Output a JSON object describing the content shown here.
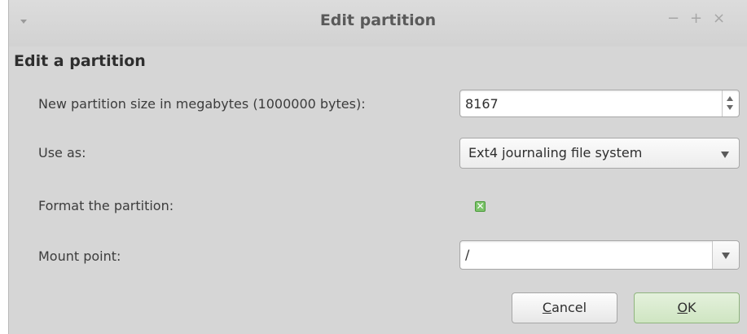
{
  "window": {
    "title": "Edit partition",
    "controls": {
      "minimize": "−",
      "maximize": "+",
      "close": "×"
    }
  },
  "form": {
    "heading": "Edit a partition",
    "size": {
      "label": "New partition size in megabytes (1000000 bytes):",
      "value": "8167"
    },
    "use_as": {
      "label": "Use as:",
      "selected": "Ext4 journaling file system"
    },
    "format": {
      "label": "Format the partition:",
      "checked": true,
      "mark": "✕"
    },
    "mount": {
      "label": "Mount point:",
      "value": "/"
    }
  },
  "buttons": {
    "cancel": {
      "mnemonic": "C",
      "rest": "ancel"
    },
    "ok": {
      "mnemonic": "O",
      "rest": "K"
    }
  },
  "colors": {
    "accent_green": "#7cc46a",
    "ok_button": "#d8ebcd"
  }
}
